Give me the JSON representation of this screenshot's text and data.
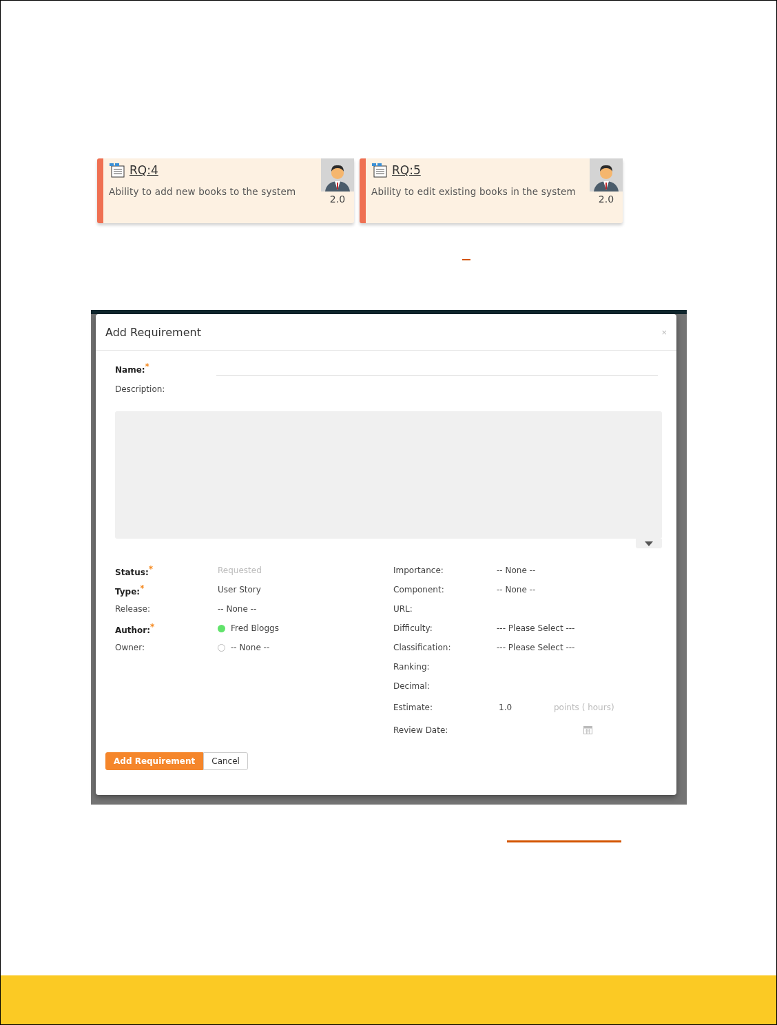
{
  "cards": [
    {
      "id": "RQ:4",
      "description": "Ability to add new books to the system",
      "estimate": "2.0"
    },
    {
      "id": "RQ:5",
      "description": "Ability to edit existing books in the system",
      "estimate": "2.0"
    }
  ],
  "dialog": {
    "title": "Add Requirement",
    "close": "×",
    "name_label": "Name:$^{*}$",
    "description_label": "Description:",
    "fields_left": [
      {
        "kind": "readonly",
        "label": "Status:$^{*}$",
        "value": "Requested"
      },
      {
        "kind": "text",
        "label": "Type:$^{*}$",
        "value": "User Story"
      },
      {
        "kind": "text",
        "label": "Release:",
        "value": "-- None --"
      },
      {
        "kind": "user",
        "label": "Author:$^{*}$",
        "value": "Fred Bloggs",
        "online": true
      },
      {
        "kind": "user",
        "label": "Owner:",
        "value": "-- None --",
        "online": false
      }
    ],
    "fields_right": [
      {
        "kind": "text",
        "label": "Importance:",
        "value": "-- None --"
      },
      {
        "kind": "text",
        "label": "Component:",
        "value": "-- None --"
      },
      {
        "kind": "empty",
        "label": "URL:"
      },
      {
        "kind": "text",
        "label": "Difficulty:",
        "value": "--- Please Select ---"
      },
      {
        "kind": "text",
        "label": "Classification:",
        "value": "--- Please Select ---"
      },
      {
        "kind": "empty",
        "label": "Ranking:"
      },
      {
        "kind": "empty",
        "label": "Decimal:"
      },
      {
        "kind": "estimate",
        "label": "Estimate:",
        "value": "1.0",
        "unit": "points ( hours)"
      },
      {
        "kind": "date",
        "label": "Review Date:"
      }
    ],
    "primary_button": "Add Requirement",
    "cancel_button": "Cancel"
  }
}
